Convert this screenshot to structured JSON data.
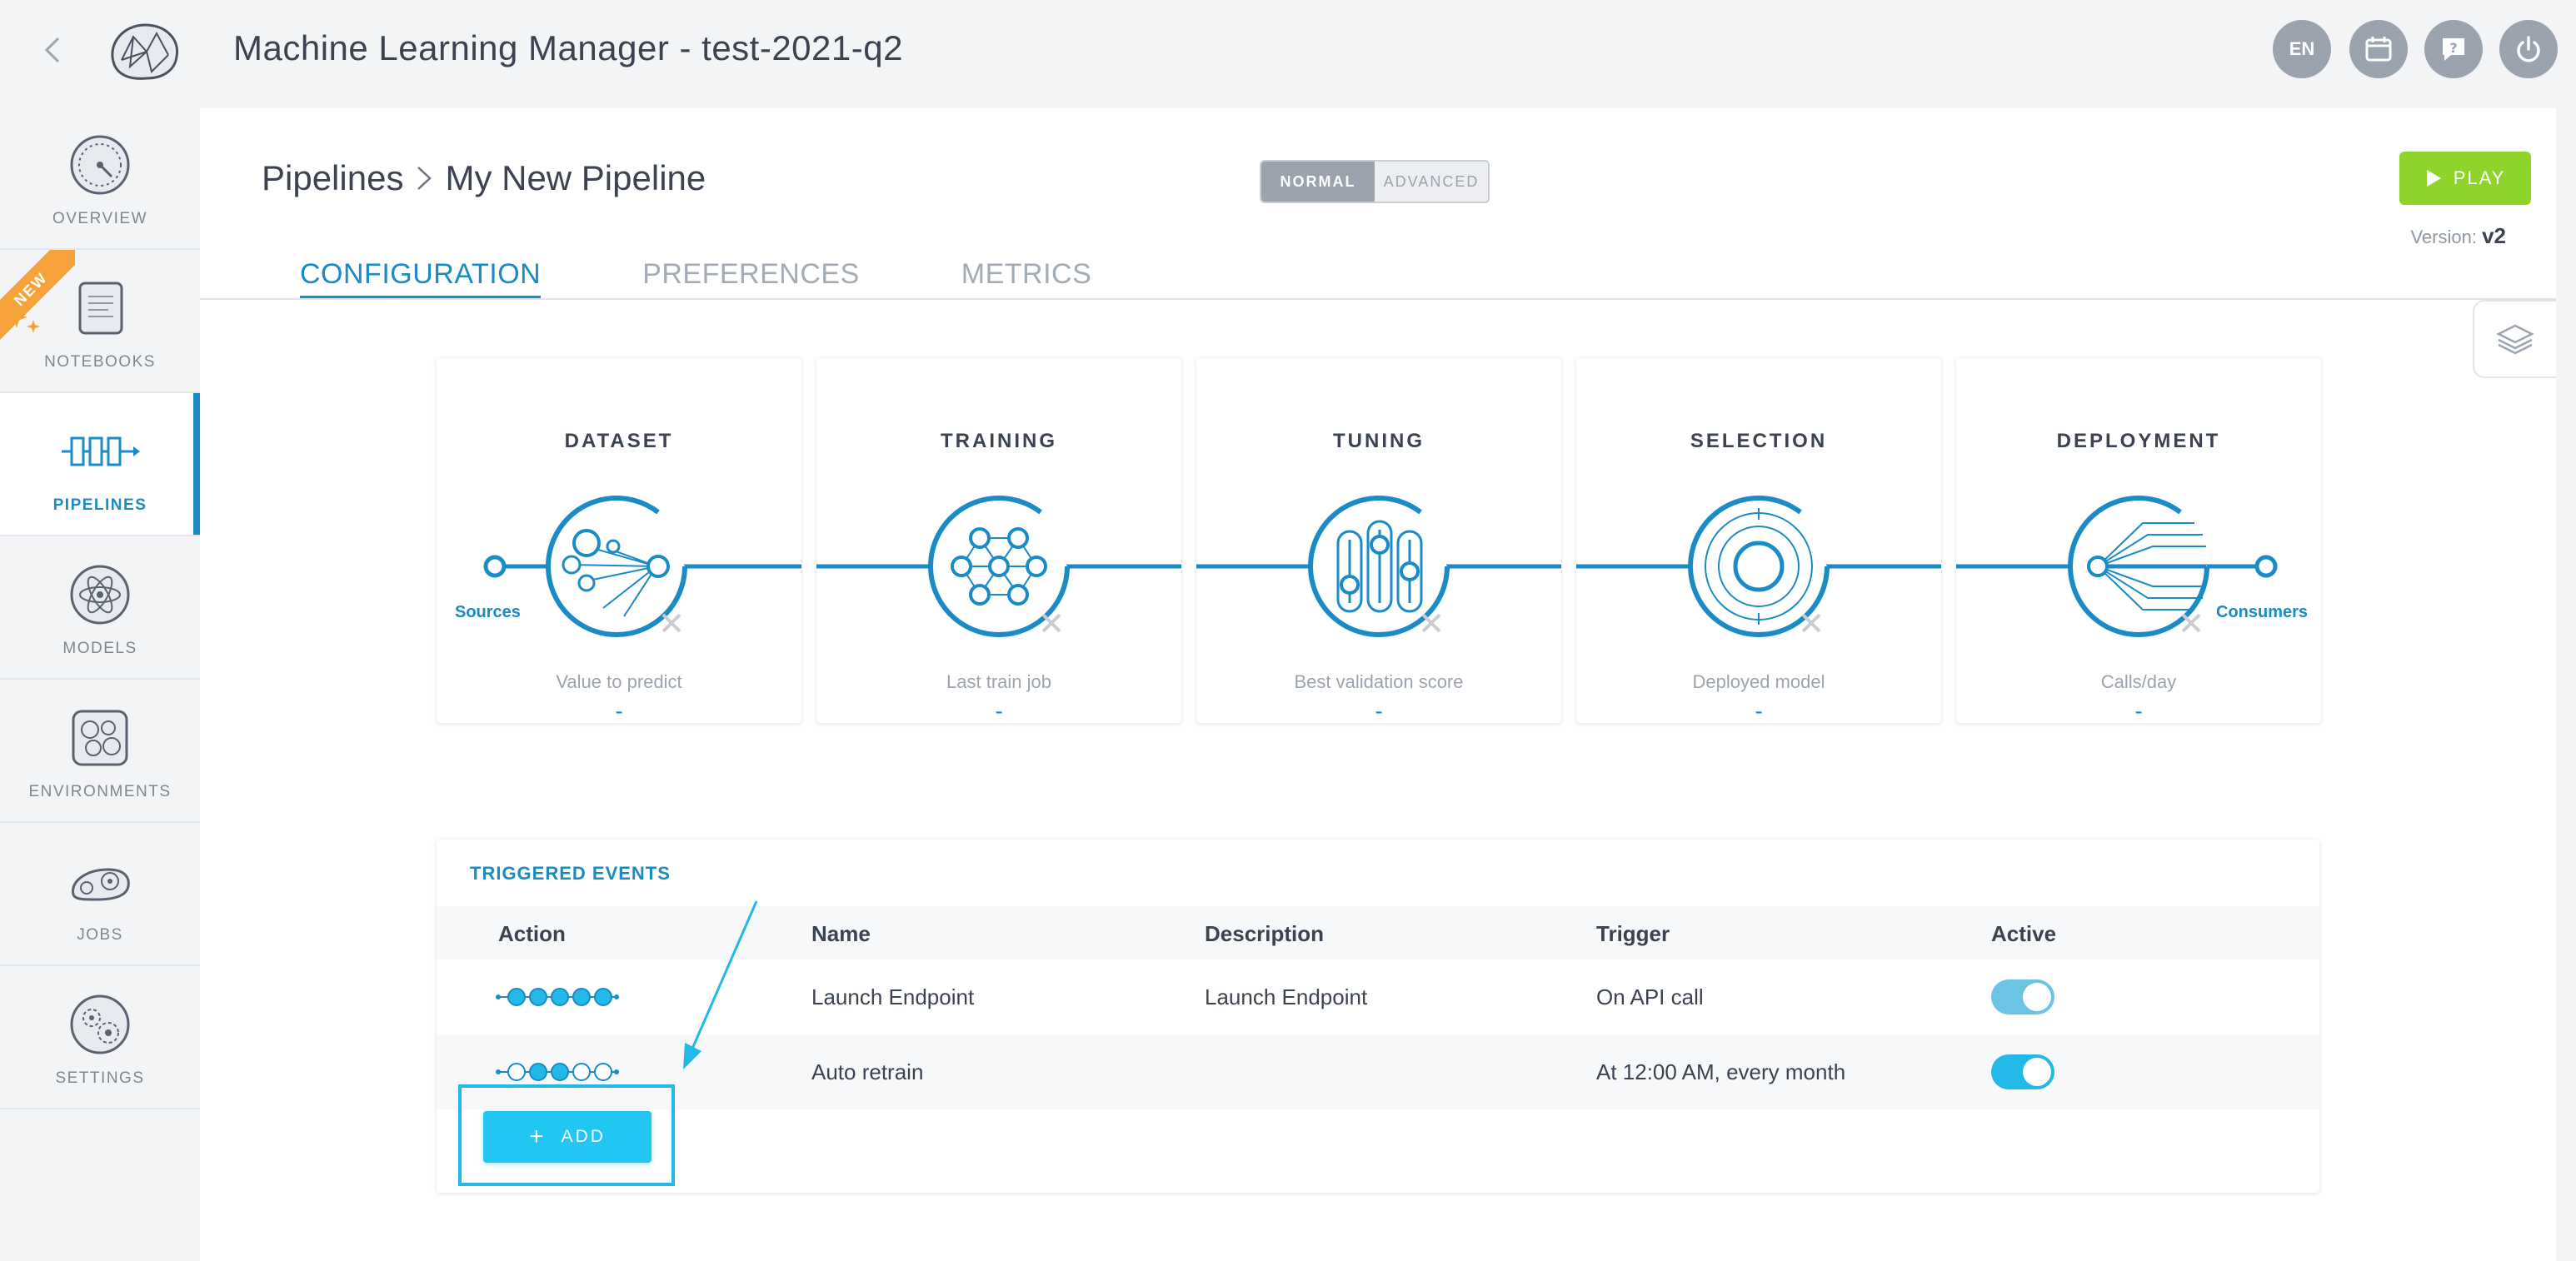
{
  "app": {
    "title": "Machine Learning Manager - test-2021-q2"
  },
  "topbar": {
    "lang": "EN"
  },
  "sidebar": {
    "new_badge": "NEW",
    "items": [
      {
        "label": "OVERVIEW",
        "icon": "gauge-icon"
      },
      {
        "label": "NOTEBOOKS",
        "icon": "notebook-icon"
      },
      {
        "label": "PIPELINES",
        "icon": "pipeline-icon"
      },
      {
        "label": "MODELS",
        "icon": "atom-icon"
      },
      {
        "label": "ENVIRONMENTS",
        "icon": "environment-icon"
      },
      {
        "label": "JOBS",
        "icon": "gears-icon"
      },
      {
        "label": "SETTINGS",
        "icon": "settings-icon"
      }
    ]
  },
  "header": {
    "breadcrumb": [
      "Pipelines",
      "My New Pipeline"
    ],
    "mode": {
      "normal": "NORMAL",
      "advanced": "ADVANCED"
    },
    "play_label": "PLAY",
    "version_label": "Version:",
    "version_value": "v2",
    "tabs": [
      "CONFIGURATION",
      "PREFERENCES",
      "METRICS"
    ]
  },
  "pipeline": {
    "start_label": "Sources",
    "end_label": "Consumers",
    "cards": [
      {
        "title": "DATASET",
        "metric": "Value to predict",
        "value": "-"
      },
      {
        "title": "TRAINING",
        "metric": "Last train job",
        "value": "-"
      },
      {
        "title": "TUNING",
        "metric": "Best validation score",
        "value": "-"
      },
      {
        "title": "SELECTION",
        "metric": "Deployed model",
        "value": "-"
      },
      {
        "title": "DEPLOYMENT",
        "metric": "Calls/day",
        "value": "-"
      }
    ]
  },
  "events": {
    "title": "TRIGGERED EVENTS",
    "columns": [
      "Action",
      "Name",
      "Description",
      "Trigger",
      "Active"
    ],
    "rows": [
      {
        "name": "Launch Endpoint",
        "description": "Launch Endpoint",
        "trigger": "On API call",
        "active": true
      },
      {
        "name": "Auto retrain",
        "description": "",
        "trigger": "At 12:00 AM, every month",
        "active": true
      }
    ],
    "add_label": "ADD"
  },
  "colors": {
    "accent": "#1a8bc4",
    "play": "#8fd42b",
    "add": "#22c6f2",
    "new_ribbon": "#f5a23a"
  }
}
